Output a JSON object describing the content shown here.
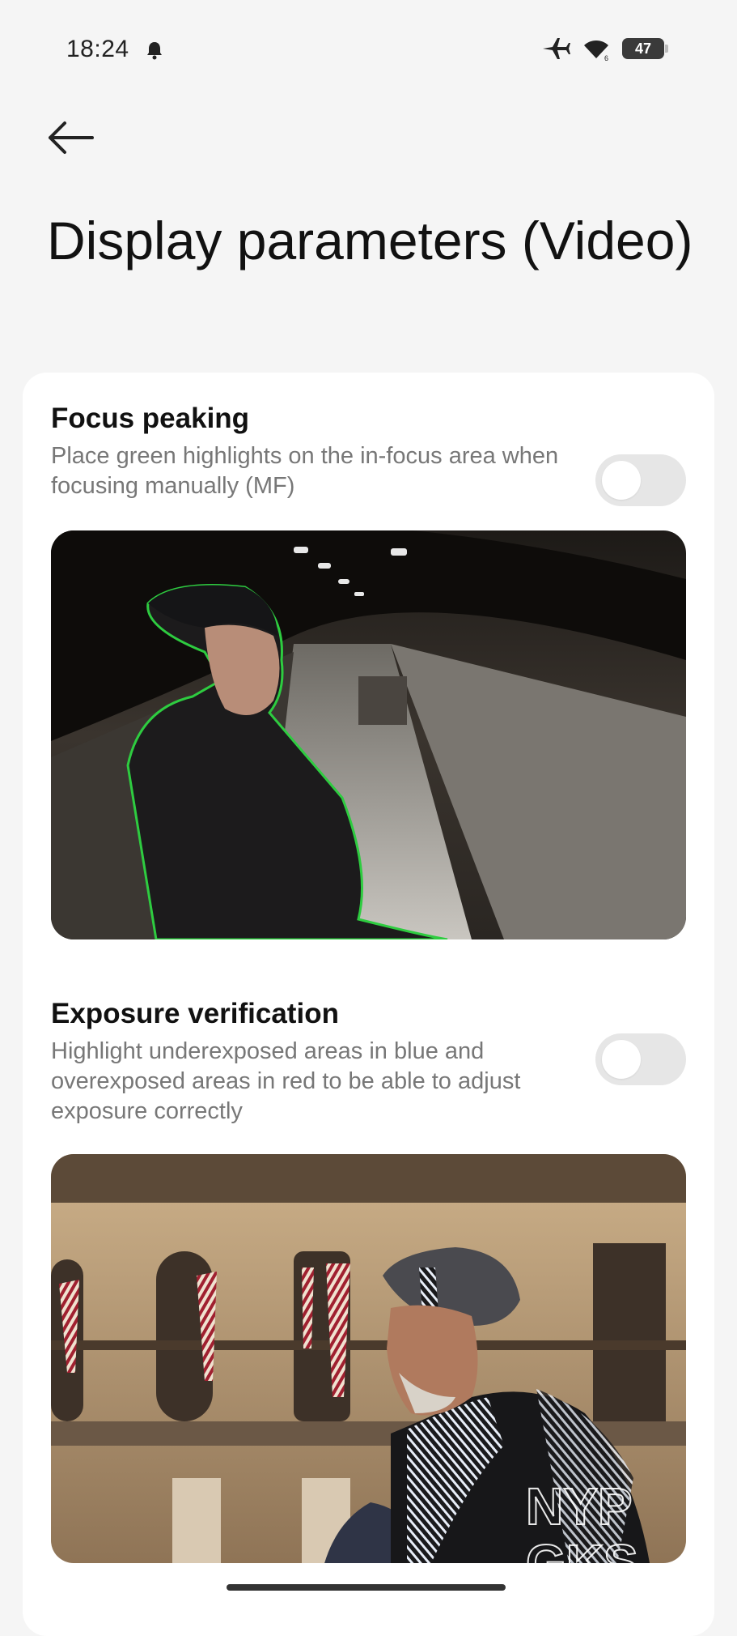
{
  "status_bar": {
    "time": "18:24",
    "battery": "47",
    "icons": [
      "bell-icon",
      "airplane-icon",
      "wifi-icon",
      "battery-icon"
    ]
  },
  "header": {
    "back_icon": "arrow-left-icon",
    "title": "Display parameters (Video)"
  },
  "settings": [
    {
      "title": "Focus peaking",
      "description": "Place green highlights on the in-focus area when focusing manually (MF)",
      "enabled": false
    },
    {
      "title": "Exposure verification",
      "description": "Highlight underexposed areas in blue and overexposed areas in red to be able to adjust exposure correctly",
      "enabled": false
    }
  ],
  "watermark": {
    "line1": "NYP",
    "line2": "GKS"
  },
  "colors": {
    "focus_highlight": "#2ecc40",
    "toggle_off": "#e6e6e6",
    "underexposed": "#4a6fb5",
    "overexposed": "#a02030"
  }
}
